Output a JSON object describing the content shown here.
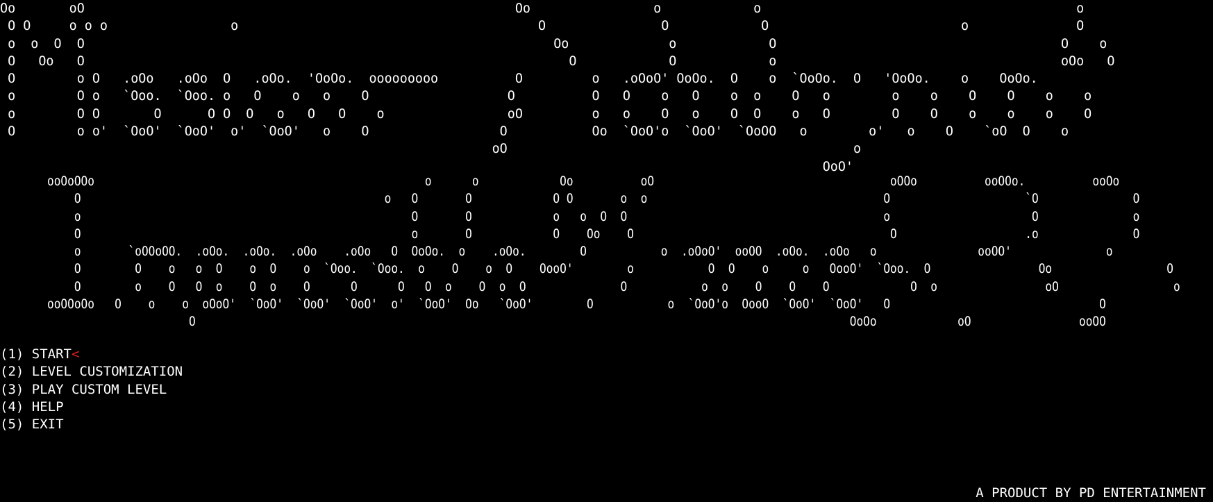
{
  "title_art": {
    "top": "Oo       oO                                                        Oo                o            o                                         o\n O O     o o o                o                                       O               O            O                         o              O\n o  o  O  O                                                             Oo             o            O                                     O    o\n O   Oo   O                                                               O            O            o                                     oOo   O\n O        o O   .oOo   .oOo  O   .oOo.  'OoOo.  ooooooooo          O         o   .oOoO' OoOo.  O    o  `OoOo.  O   'OoOo.    o    OoOo.\n o        O o   `Ooo.  `Ooo. o   O    o   o    O                  O          O   O    o   O    o  o    O   o        o    o    O    O    o    o\n o        O O       O      O O  O   o   O   O    o                oO         o   o    O   o    O  O    o   O        O    O    o    o    o    O\n O        o o'  `OoO'  `OoO'  o'  `OoO'   o    O                 O           Oo  `OoO'o  `OoO'  `OoOO   o        o'   o    O    `oO  O    o\n                                                                oO                                             o\n                                                                                                           OoO'",
    "bottom": "       ooOoOOo                                                 o      o            Oo          oO                                   oOOo          ooOOo.          ooOo\n           O                                             o   O       O            O O       o  o                                   O                    `O              O\n           o                                                 O       O            o   o  O  O                                      o                     O              o\n           O                                                 o       O            O    Oo    O                                      O                   .o              O\n           o       `oOOoOO.  .oOo.  .oOo.  .oOo    .oOo   O  OoOo.  o    .oOo.        O           o  .oOoO'  ooOO  .oOo.  .oOo   o               ooOO'              o\n           O        O    o   o  O    o  O    o  `Ooo.  `Ooo.  o    O    o  O    OooO'        o           O  O    o     o   OooO'  `Ooo.  O                Oo                 O\n           O        o    O   O  o    O  o    O      O      O   O  o    O  o  O              O           o  o    O    O    O            O  o                oO                 o\n       ooOOoOo   O    o    o  oOoO'  `OoO'  `OoO'  `OoO'  o'  `OoO'  Oo   `OoO'        O           o  `OoO'o  OooO  `OoO'  `OoO'   O                               O\n                            O                                                                                                 OoOo            oO                ooOO"
  },
  "menu": {
    "items": [
      {
        "label": "(1) START",
        "selected": true
      },
      {
        "label": "(2) LEVEL CUSTOMIZATION",
        "selected": false
      },
      {
        "label": "(3) PLAY CUSTOM LEVEL",
        "selected": false
      },
      {
        "label": "(4) HELP",
        "selected": false
      },
      {
        "label": "(5) EXIT",
        "selected": false
      }
    ],
    "selection_marker": "<",
    "marker_color": "#e02020"
  },
  "footer": {
    "credit": "A PRODUCT BY PD ENTERTAINMENT"
  },
  "colors": {
    "background": "#000000",
    "text": "#ffffff",
    "accent": "#e02020"
  }
}
